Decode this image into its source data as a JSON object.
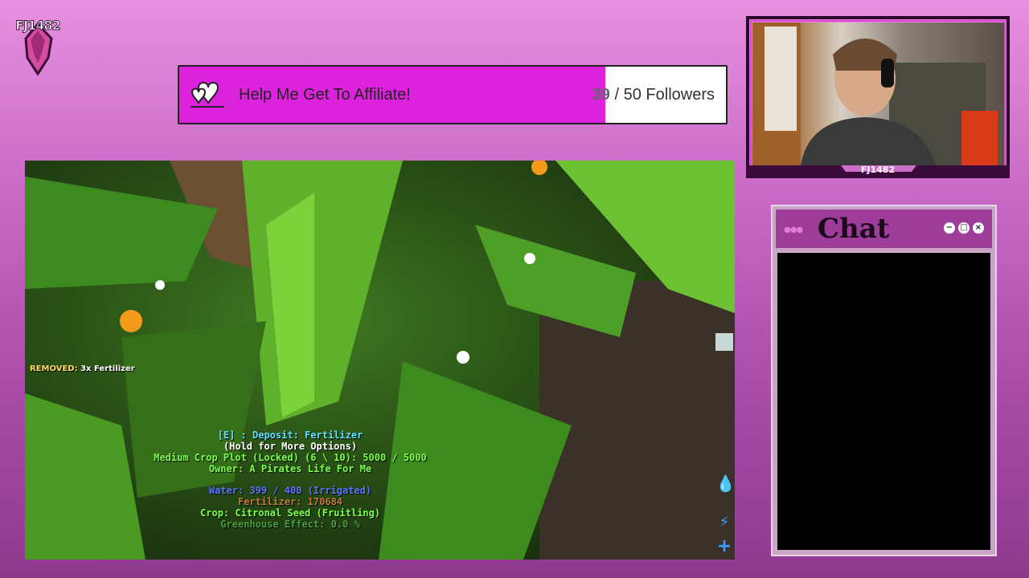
{
  "logo": {
    "text": "FJ1482",
    "icon": "dragon-logo-icon"
  },
  "goal": {
    "title": "Help Me Get To Affiliate!",
    "current": "39",
    "target_text": " / 50 Followers",
    "progress_fraction": 0.78,
    "icon": "heart-icon",
    "fill_color": "#dd22dd"
  },
  "game": {
    "removed_prefix": "REMOVED:",
    "removed_text": "3x  Fertilizer",
    "hud": {
      "deposit": "[E] : Deposit: Fertilizer",
      "hold": "(Hold for More Options)",
      "plot": "Medium Crop Plot (Locked)  (6 \\ 10): 5000 / 5000",
      "owner": "Owner: A Pirates Life For Me",
      "water": "Water: 399 / 400 (Irrigated)",
      "fertilizer": "Fertilizer: 170684",
      "crop": "Crop: Citronal Seed (Fruitling)",
      "greenhouse": "Greenhouse Effect: 0.0 %"
    }
  },
  "webcam": {
    "name": "FJ1482"
  },
  "chat": {
    "title": "Chat",
    "dots": "●●●",
    "minimize": "−",
    "maximize": "□",
    "close": "×"
  }
}
